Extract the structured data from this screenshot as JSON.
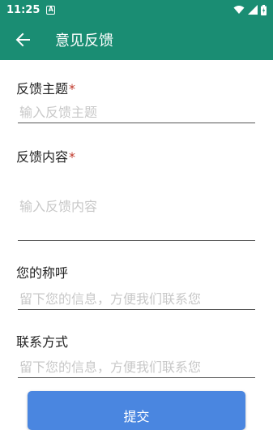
{
  "status_bar": {
    "time": "11:25",
    "notification_icon": "a-notification-icon",
    "wifi_icon": "wifi-icon",
    "signal_icon": "signal-icon",
    "battery_icon": "battery-icon"
  },
  "app_bar": {
    "title": "意见反馈",
    "back_icon": "arrow-left-icon",
    "background": "#1a8d73"
  },
  "form": {
    "subject": {
      "label": "反馈主题",
      "required_mark": "*",
      "placeholder": "输入反馈主题",
      "value": ""
    },
    "content": {
      "label": "反馈内容",
      "required_mark": "*",
      "placeholder": "输入反馈内容",
      "value": ""
    },
    "name": {
      "label": "您的称呼",
      "placeholder": "留下您的信息，方便我们联系您",
      "value": ""
    },
    "contact": {
      "label": "联系方式",
      "placeholder": "留下您的信息，方便我们联系您",
      "value": ""
    }
  },
  "submit": {
    "label": "提交",
    "color": "#4a86e0"
  }
}
